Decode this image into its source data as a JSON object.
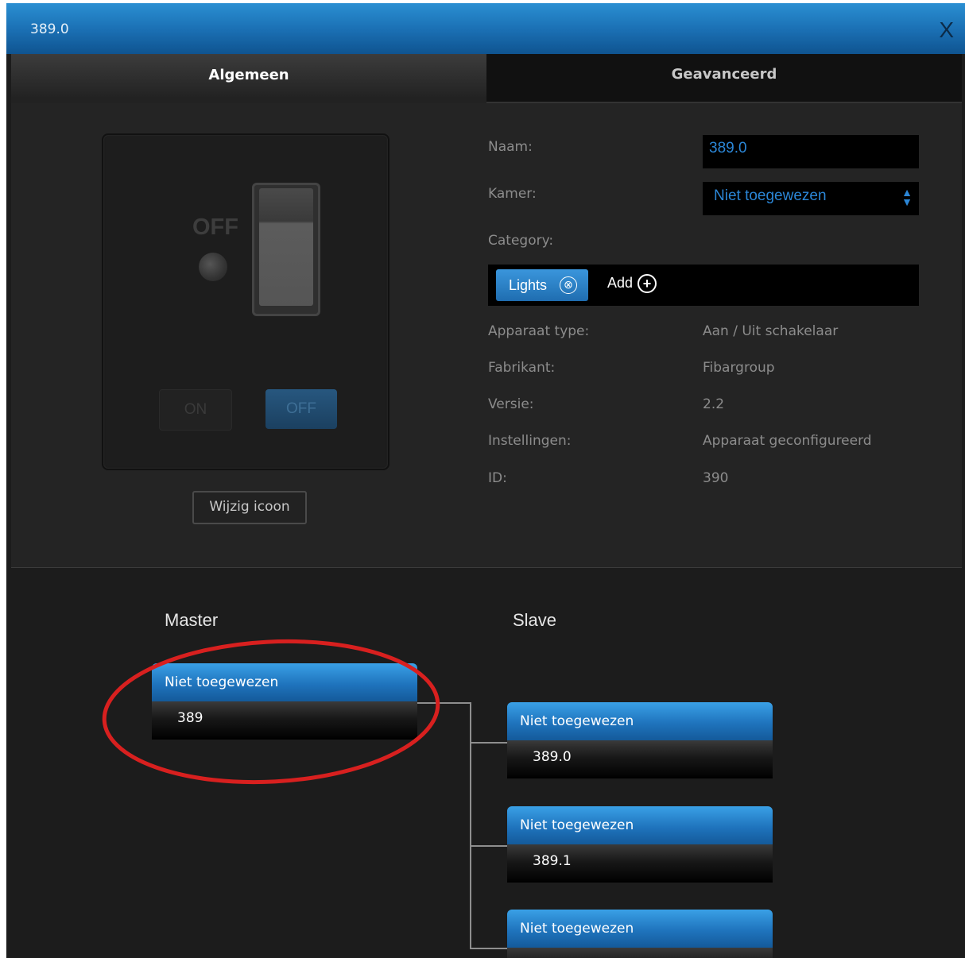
{
  "window": {
    "title": "389.0",
    "close_label": "X"
  },
  "tabs": [
    {
      "label": "Algemeen"
    },
    {
      "label": "Geavanceerd"
    }
  ],
  "preview": {
    "state_text": "OFF",
    "on_button": "ON",
    "off_button": "OFF",
    "change_icon_button": "Wijzig icoon"
  },
  "form": {
    "naam_label": "Naam:",
    "naam_value": "389.0",
    "kamer_label": "Kamer:",
    "kamer_value": "Niet toegewezen",
    "category_label": "Category:",
    "category_tag": "Lights",
    "category_tag_remove": "⊗",
    "add_label": "Add",
    "add_icon": "+",
    "apparaat_type_label": "Apparaat type:",
    "apparaat_type_value": "Aan / Uit schakelaar",
    "fabrikant_label": "Fabrikant:",
    "fabrikant_value": "Fibargroup",
    "versie_label": "Versie:",
    "versie_value": "2.2",
    "instellingen_label": "Instellingen:",
    "instellingen_value": "Apparaat geconfigureerd",
    "id_label": "ID:",
    "id_value": "390"
  },
  "tree": {
    "master_title": "Master",
    "slave_title": "Slave",
    "master": {
      "room": "Niet toegewezen",
      "name": "389"
    },
    "slaves": [
      {
        "room": "Niet toegewezen",
        "name": "389.0"
      },
      {
        "room": "Niet toegewezen",
        "name": "389.1"
      },
      {
        "room": "Niet toegewezen",
        "name": ""
      }
    ]
  },
  "colors": {
    "accent": "#1f74bd",
    "annotation": "#d8201f",
    "field_text": "#2b86d6"
  }
}
